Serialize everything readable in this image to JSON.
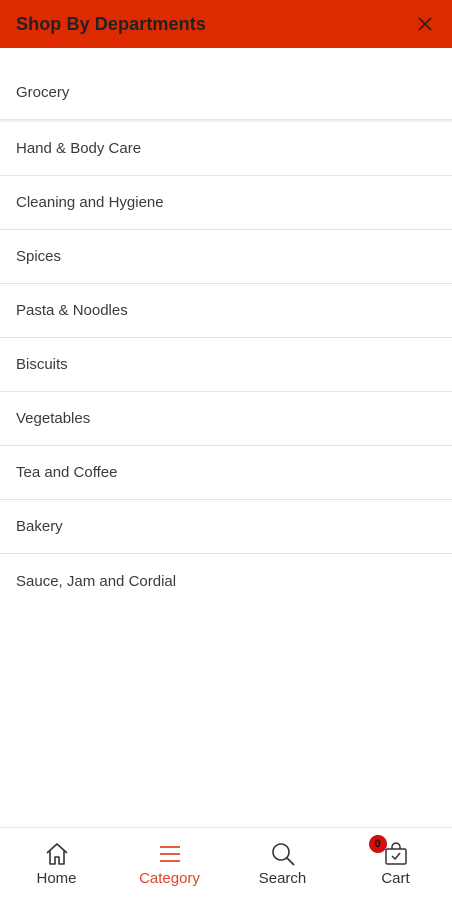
{
  "header": {
    "title": "Shop By Departments",
    "close_icon": "close-icon",
    "background": "#de2a00"
  },
  "departments": [
    "Grocery",
    "Hand & Body Care",
    "Cleaning and Hygiene",
    "Spices",
    "Pasta & Noodles",
    "Biscuits",
    "Vegetables",
    "Tea and Coffee",
    "Bakery",
    "Sauce, Jam and Cordial"
  ],
  "bottom_nav": {
    "home": {
      "label": "Home",
      "icon": "home-icon"
    },
    "category": {
      "label": "Category",
      "icon": "menu-icon",
      "active": true,
      "color": "#e0442a"
    },
    "search": {
      "label": "Search",
      "icon": "search-icon"
    },
    "cart": {
      "label": "Cart",
      "icon": "cart-icon",
      "badge_count": "0",
      "badge_color": "#d10f0f"
    }
  }
}
